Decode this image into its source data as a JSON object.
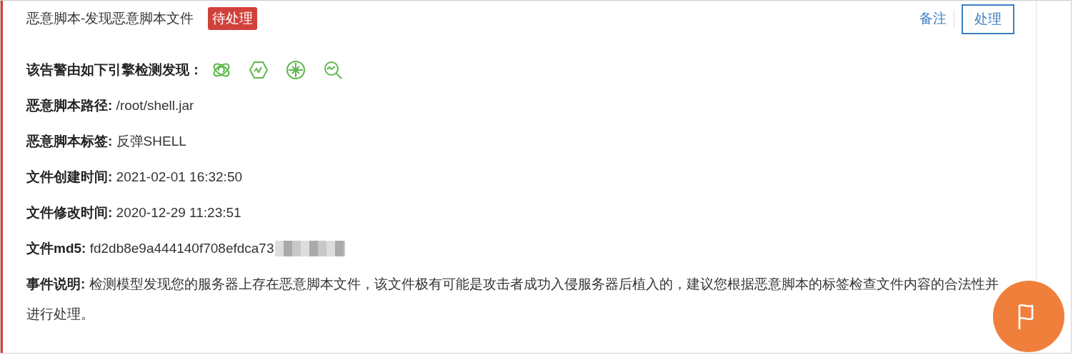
{
  "alert": {
    "title": "恶意脚本-发现恶意脚本文件",
    "status": "待处理",
    "actions": [
      {
        "label": "备注",
        "kind": "link"
      },
      {
        "label": "处理",
        "kind": "button"
      }
    ]
  },
  "engines_label": "该告警由如下引擎检测发现：",
  "fields": [
    {
      "label": "恶意脚本路径:",
      "value": "/root/shell.jar"
    },
    {
      "label": "恶意脚本标签:",
      "value": "反弹SHELL"
    },
    {
      "label": "文件创建时间:",
      "value": "2021-02-01 16:32:50"
    },
    {
      "label": "文件修改时间:",
      "value": "2020-12-29 11:23:51"
    },
    {
      "label": "文件md5:",
      "value": "fd2db8e9a444140f708efdca73",
      "redacted": true
    },
    {
      "label": "事件说明:",
      "value": "检测模型发现您的服务器上存在恶意脚本文件，该文件极有可能是攻击者成功入侵服务器后植入的，建议您根据恶意脚本的标签检查文件内容的合法性并进行处理。"
    }
  ]
}
